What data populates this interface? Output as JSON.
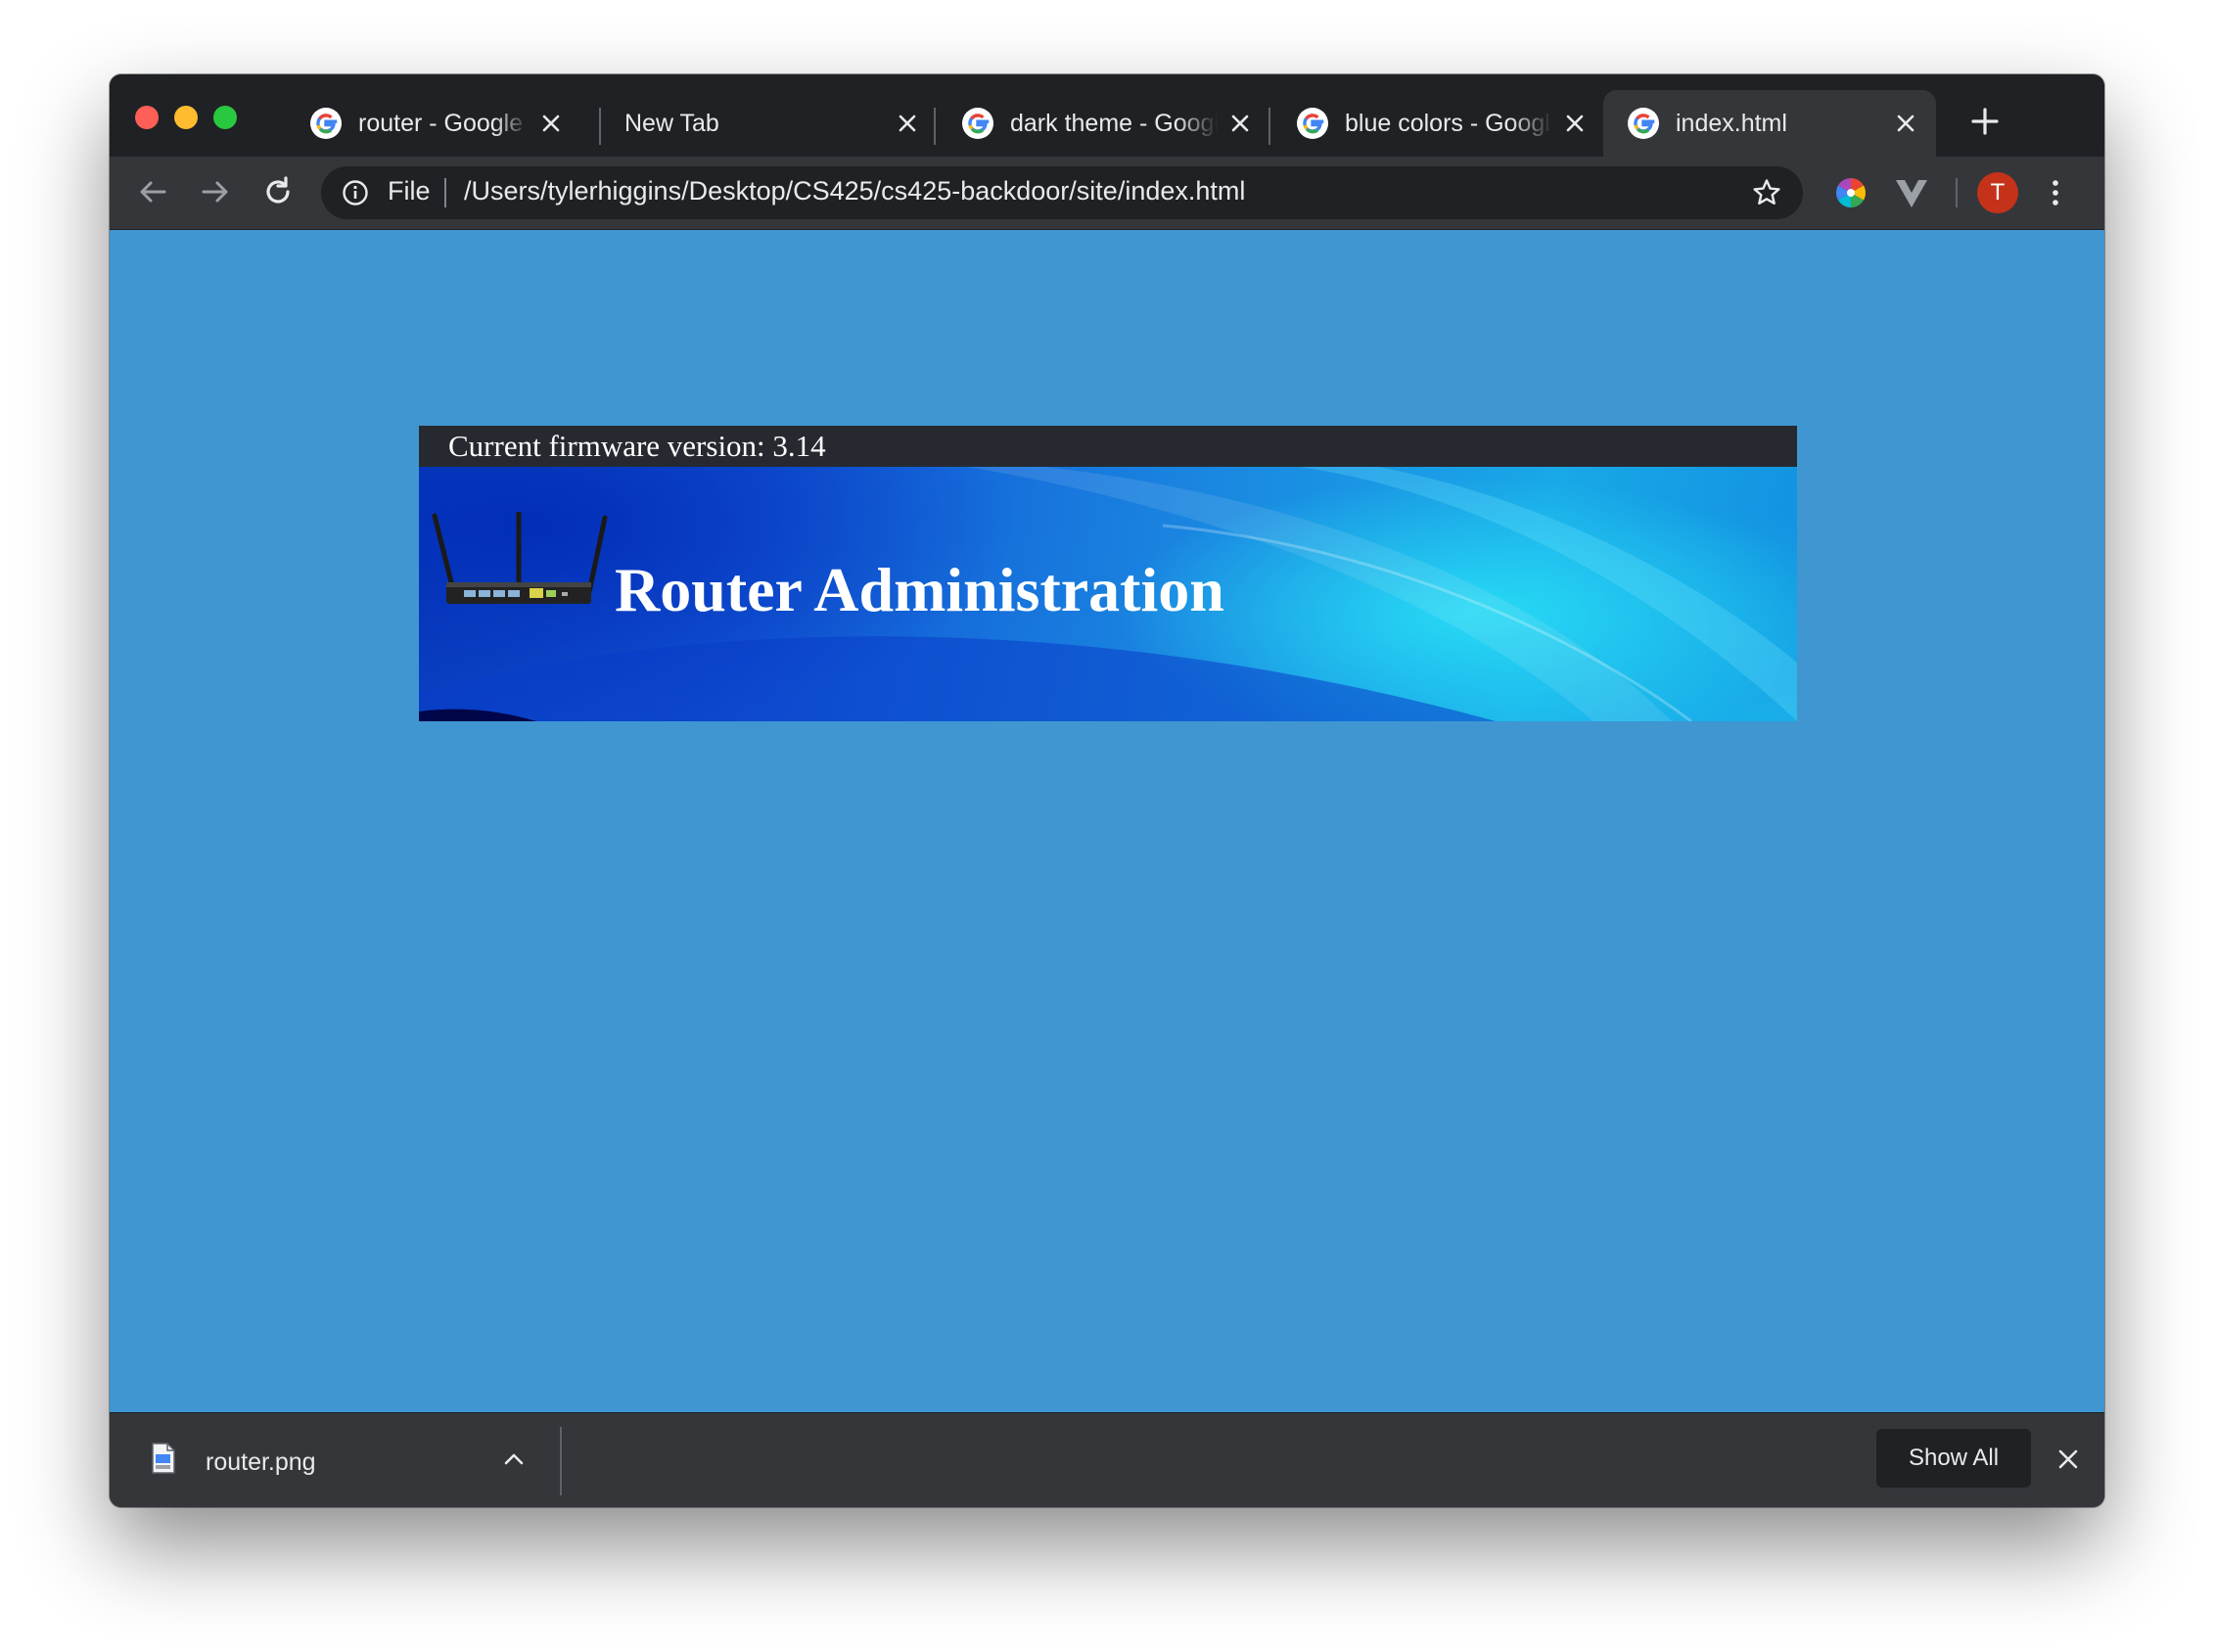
{
  "tabs": [
    {
      "title": "router - Google Search"
    },
    {
      "title": "New Tab"
    },
    {
      "title": "dark theme - Google Search"
    },
    {
      "title": "blue colors - Google Search"
    },
    {
      "title": "index.html"
    }
  ],
  "omnibox": {
    "scheme_label": "File",
    "url": "/Users/tylerhiggins/Desktop/CS425/cs425-backdoor/site/index.html"
  },
  "profile": {
    "initial": "T",
    "color": "#c5321a"
  },
  "page": {
    "background_color": "#3f96d1",
    "firmware_text": "Current firmware version: 3.14",
    "title": "Router Administration"
  },
  "download_bar": {
    "file_name": "router.png",
    "show_all_label": "Show All"
  }
}
